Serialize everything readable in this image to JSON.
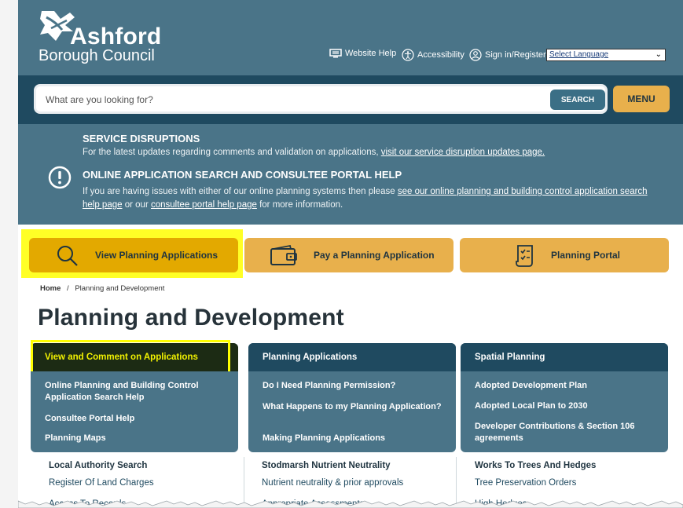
{
  "header": {
    "org_name": "Ashford",
    "org_sub": "Borough Council",
    "website_help": "Website Help",
    "accessibility": "Accessibility",
    "sign_in": "Sign in/Register",
    "language_select": "Select Language"
  },
  "search": {
    "placeholder": "What are you looking for?",
    "search_label": "SEARCH",
    "menu_label": "MENU"
  },
  "notice": {
    "disruptions_title": "SERVICE DISRUPTIONS",
    "disruptions_text": "For the latest updates regarding comments and validation on applications,",
    "disruptions_link": "visit our service disruption updates page.",
    "portal_title": "ONLINE APPLICATION SEARCH AND CONSULTEE PORTAL HELP",
    "portal_text_1": "If you are having issues with either of our online planning systems then please",
    "portal_link_1": "see our online planning and building control application search help page",
    "portal_text_2": "or our",
    "portal_link_2": "consultee portal help page",
    "portal_text_3": "for more information."
  },
  "quick_buttons": [
    {
      "label": "View Planning Applications",
      "icon": "search-icon"
    },
    {
      "label": "Pay a Planning Application",
      "icon": "wallet-icon"
    },
    {
      "label": "Planning Portal",
      "icon": "document-checklist-icon"
    }
  ],
  "breadcrumb": {
    "home": "Home",
    "sep": "/",
    "current": "Planning and Development"
  },
  "page_title": "Planning and Development",
  "cards": [
    {
      "title": "View and Comment on Applications",
      "links": [
        "Online Planning and Building Control Application Search Help",
        "Consultee Portal Help",
        "Planning Maps"
      ]
    },
    {
      "title": "Planning Applications",
      "links": [
        "Do I Need Planning Permission?",
        "What Happens to my Planning Application?",
        "Making Planning Applications"
      ]
    },
    {
      "title": "Spatial Planning",
      "links": [
        "Adopted Development Plan",
        "Adopted Local Plan to 2030",
        "Developer Contributions & Section 106 agreements"
      ]
    }
  ],
  "sections": [
    {
      "title": "Local Authority Search",
      "link": "Register Of Land Charges",
      "cut": "Access To Records"
    },
    {
      "title": "Stodmarsh Nutrient Neutrality",
      "link": "Nutrient neutrality & prior approvals",
      "cut": "Appropriate Assessments"
    },
    {
      "title": "Works To Trees And Hedges",
      "link": "Tree Preservation Orders",
      "cut": "High Hedges"
    }
  ],
  "colors": {
    "header": "#4a7488",
    "dark_band": "#1f4a60",
    "accent": "#e8b04c",
    "highlight": "#ffff00"
  }
}
